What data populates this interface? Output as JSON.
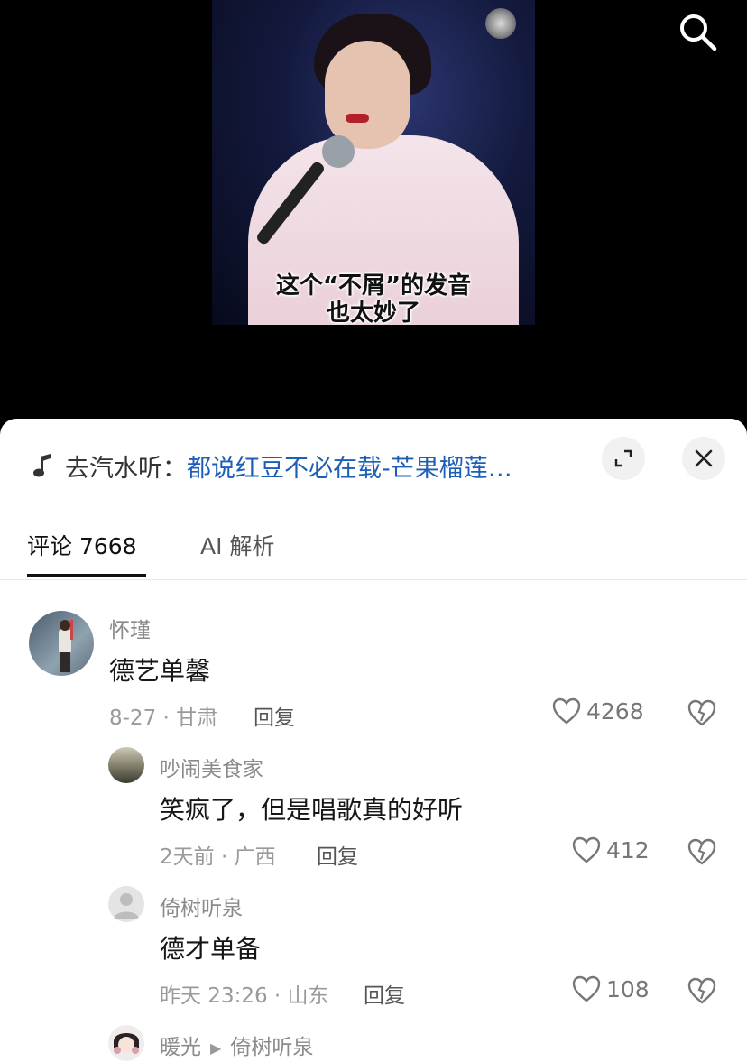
{
  "video": {
    "subtitle_line1": "这个“不屑”的发音",
    "subtitle_line2": "也太妙了"
  },
  "top_bar": {
    "search_icon": "search-icon"
  },
  "music": {
    "prefix": "去汽水听：",
    "song": "都说红豆不必在载-芒果榴莲…",
    "icon": "music-note-icon"
  },
  "tabs": [
    {
      "label": "评论 7668",
      "active": true
    },
    {
      "label": "AI 解析",
      "active": false
    }
  ],
  "comments": [
    {
      "user": "怀瑾",
      "text": "德艺单馨",
      "meta": "8-27 · 甘肃",
      "reply_label": "回复",
      "likes": "4268"
    },
    {
      "user": "吵闹美食家",
      "text": "笑疯了，但是唱歌真的好听",
      "meta": "2天前 · 广西",
      "reply_label": "回复",
      "likes": "412"
    },
    {
      "user": "倚树听泉",
      "text": "德才单备",
      "meta": "昨天 23:26 · 山东",
      "reply_label": "回复",
      "likes": "108"
    },
    {
      "user": "暖光",
      "reply_to": "倚树听泉"
    }
  ],
  "colors": {
    "accent_link": "#1d5fb8",
    "text": "#161616",
    "muted": "#9a9a9a"
  }
}
